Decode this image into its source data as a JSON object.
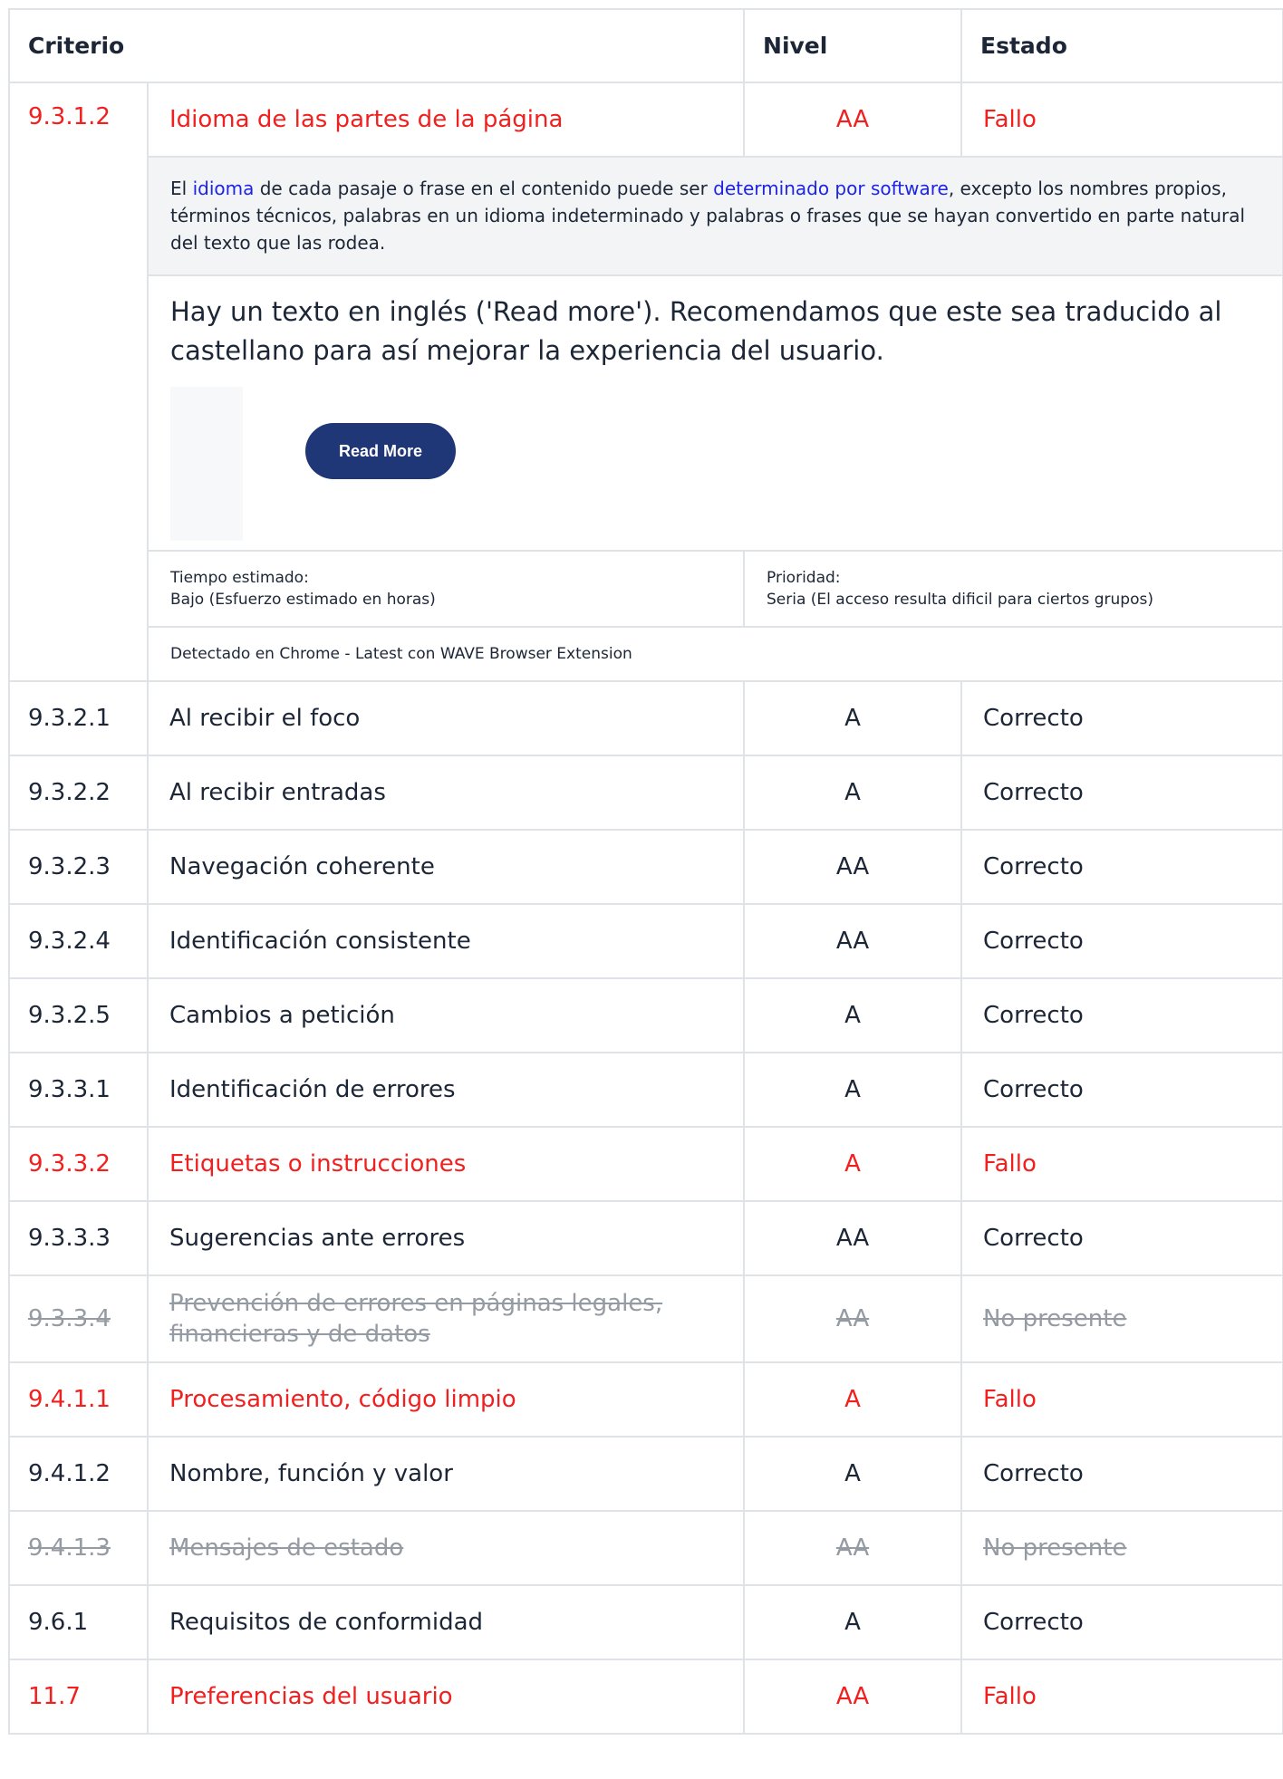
{
  "header": {
    "criterio": "Criterio",
    "nivel": "Nivel",
    "estado": "Estado"
  },
  "expanded": {
    "id": "9.3.1.2",
    "name": "Idioma de las partes de la página",
    "level": "AA",
    "status": "Fallo",
    "desc_pre": "El ",
    "desc_link1": "idioma",
    "desc_mid": " de cada pasaje o frase en el contenido puede ser ",
    "desc_link2": "determinado por software",
    "desc_post": ", excepto los nombres propios, términos técnicos, palabras en un idioma indeterminado y palabras o frases que se hayan convertido en parte natural del texto que las rodea.",
    "note": "Hay un texto en inglés ('Read more'). Recomendamos que este sea traducido al castellano para así mejorar la experiencia del usuario.",
    "button_label": "Read More",
    "time_label": "Tiempo estimado:",
    "time_value": "Bajo (Esfuerzo estimado en horas)",
    "priority_label": "Prioridad:",
    "priority_value": "Seria (El acceso resulta dificil para ciertos grupos)",
    "detected": "Detectado en Chrome - Latest con WAVE Browser Extension"
  },
  "rows": [
    {
      "id": "9.3.2.1",
      "name": "Al recibir el foco",
      "level": "A",
      "status": "Correcto"
    },
    {
      "id": "9.3.2.2",
      "name": "Al recibir entradas",
      "level": "A",
      "status": "Correcto"
    },
    {
      "id": "9.3.2.3",
      "name": "Navegación coherente",
      "level": "AA",
      "status": "Correcto"
    },
    {
      "id": "9.3.2.4",
      "name": "Identificación consistente",
      "level": "AA",
      "status": "Correcto"
    },
    {
      "id": "9.3.2.5",
      "name": "Cambios a petición",
      "level": "A",
      "status": "Correcto"
    },
    {
      "id": "9.3.3.1",
      "name": "Identificación de errores",
      "level": "A",
      "status": "Correcto"
    },
    {
      "id": "9.3.3.2",
      "name": "Etiquetas o instrucciones",
      "level": "A",
      "status": "Fallo"
    },
    {
      "id": "9.3.3.3",
      "name": "Sugerencias ante errores",
      "level": "AA",
      "status": "Correcto"
    },
    {
      "id": "9.3.3.4",
      "name": "Prevención de errores en páginas legales, financieras y de datos",
      "level": "AA",
      "status": "No presente"
    },
    {
      "id": "9.4.1.1",
      "name": "Procesamiento, código limpio",
      "level": "A",
      "status": "Fallo"
    },
    {
      "id": "9.4.1.2",
      "name": "Nombre, función y valor",
      "level": "A",
      "status": "Correcto"
    },
    {
      "id": "9.4.1.3",
      "name": "Mensajes de estado",
      "level": "AA",
      "status": "No presente"
    },
    {
      "id": "9.6.1",
      "name": "Requisitos de conformidad",
      "level": "A",
      "status": "Correcto"
    },
    {
      "id": "11.7",
      "name": "Preferencias del usuario",
      "level": "AA",
      "status": "Fallo"
    }
  ],
  "colors": {
    "fail": "#f21f1f",
    "absent": "#959ba3",
    "link": "#1d24e6",
    "button": "#1f3677"
  }
}
